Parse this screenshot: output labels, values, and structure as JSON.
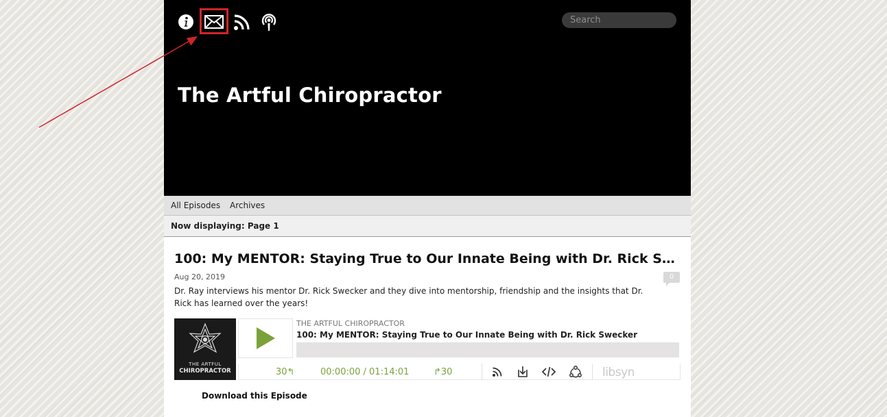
{
  "header": {
    "site_title": "The Artful Chiropractor",
    "search_placeholder": "Search",
    "icons": [
      "info-icon",
      "mail-icon",
      "rss-icon",
      "podcast-icon"
    ],
    "background_color": "#000000"
  },
  "nav": {
    "items": [
      {
        "label": "All Episodes"
      },
      {
        "label": "Archives"
      }
    ]
  },
  "page_indicator": "Now displaying: Page 1",
  "episode": {
    "title": "100: My MENTOR: Staying True to Our Innate Being with Dr. Rick Swecker",
    "date": "Aug 20, 2019",
    "comment_count": "0",
    "description": "Dr. Ray interviews his mentor Dr. Rick Swecker and they dive into mentorship, friendship and the insights that Dr. Rick has learned over the years!",
    "download_label": "Download this Episode"
  },
  "player": {
    "cover_line1": "THE ARTFUL",
    "cover_line2": "CHIROPRACTOR",
    "show_name": "THE ARTFUL CHIROPRACTOR",
    "episode_title": "100: My MENTOR: Staying True to Our Innate Being with Dr. Rick Swecker",
    "skip_back_label": "30↰",
    "time_display": "00:00:00 / 01:14:01",
    "skip_forward_label": "↱30",
    "brand": "libsyn",
    "progress": 0,
    "accent_color": "#7ba23a",
    "icons": [
      "rss-icon",
      "download-icon",
      "embed-icon",
      "share-icon"
    ]
  },
  "annotation": {
    "highlight_color": "#d2232a",
    "target": "mail-icon"
  }
}
